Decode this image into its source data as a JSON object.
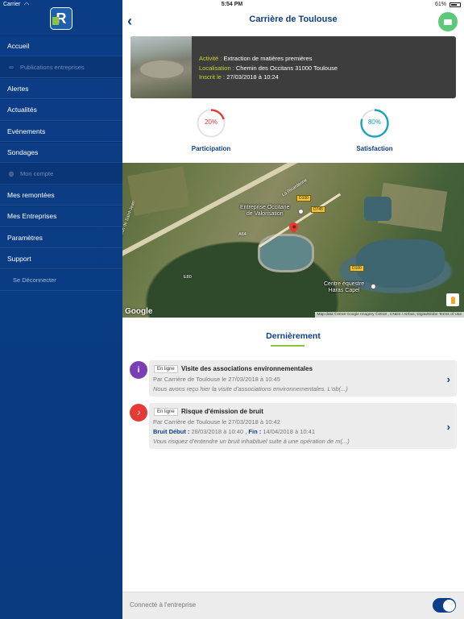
{
  "status_bar": {
    "carrier": "Carrier",
    "time": "5:54 PM",
    "battery": "61%"
  },
  "sidebar": {
    "logo": "R",
    "items": [
      {
        "label": "Accueil",
        "type": "item"
      },
      {
        "label": "Publications entreprises",
        "type": "section",
        "icon": "infinity-icon"
      },
      {
        "label": "Alertes",
        "type": "item"
      },
      {
        "label": "Actualités",
        "type": "item"
      },
      {
        "label": "Evénements",
        "type": "item"
      },
      {
        "label": "Sondages",
        "type": "item"
      },
      {
        "label": "Mon compte",
        "type": "section",
        "icon": "globe-icon"
      },
      {
        "label": "Mes remontées",
        "type": "item"
      },
      {
        "label": "Mes Entreprises",
        "type": "item"
      },
      {
        "label": "Paramètres",
        "type": "item"
      },
      {
        "label": "Support",
        "type": "item"
      },
      {
        "label": "Se Déconnecter",
        "type": "logout"
      }
    ]
  },
  "header": {
    "title": "Carrière de Toulouse",
    "back_icon": "chevron-left-icon",
    "mail_icon": "envelope-icon"
  },
  "company": {
    "activity_label": "Activité :",
    "activity": "Extraction de matières premières",
    "location_label": "Localisation :",
    "location": "Chemin des Occitans 31000 Toulouse",
    "registered_label": "Inscrit le :",
    "registered": "27/03/2018 à 10:24"
  },
  "gauges": [
    {
      "label": "Participation",
      "value": 20,
      "display": "20%",
      "color": "#e53935"
    },
    {
      "label": "Satisfaction",
      "value": 80,
      "display": "80%",
      "color": "#1aa3b8"
    }
  ],
  "map": {
    "labels": {
      "poi1_line1": "Entreprise Occitane",
      "poi1_line2": "de Valorisation",
      "poi2_line1": "Centre équestre",
      "poi2_line2": "Haras Capel",
      "road1": "La Ricardenne",
      "road2": "Chemin de Saint-Jean",
      "shield1": "D100",
      "shield2": "D745",
      "shield3": "A64",
      "shield4": "D100",
      "shield5": "E80"
    },
    "google": "Google",
    "attribution": "Map data ©2018 Google Imagery ©2018 , CNES / Airbus, DigitalGlobe   Terms of Use"
  },
  "recent": {
    "title": "Dernièrement",
    "items": [
      {
        "status": "En ligne",
        "title": "Visite des associations environnementales",
        "byline": "Par Carrière de Toulouse le 27/03/2018 à 10:45",
        "excerpt": "Nous avons reçu hier la visite d'associations environnementales. L'ob(...)",
        "icon": "info-icon",
        "color": "#7b3fb5"
      },
      {
        "status": "En ligne",
        "title": "Risque d'émission de bruit",
        "byline": "Par Carrière de Toulouse le 27/03/2018 à 10:42",
        "noise_start_label": "Bruit Début :",
        "noise_start": "28/03/2018 à 10:40 ,",
        "noise_end_label": "Fin :",
        "noise_end": "14/04/2018 à 10:41",
        "excerpt": "Vous risquez d'entendre un bruit inhabituel suite à une opération de m(...)",
        "icon": "bell-icon",
        "color": "#e53935"
      }
    ]
  },
  "bottom": {
    "label": "Connecté à l'entreprise",
    "toggle_on": true
  }
}
